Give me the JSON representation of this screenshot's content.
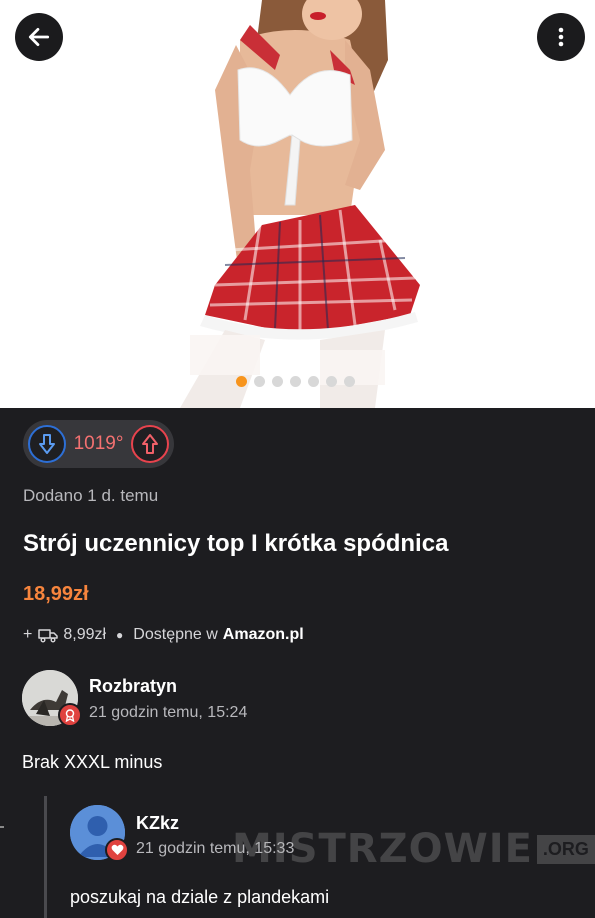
{
  "gallery": {
    "image_alt": "product-photo",
    "dot_count": 7,
    "active_dot": 0
  },
  "nav": {
    "back_icon": "arrow-left-icon",
    "more_icon": "more-vertical-icon"
  },
  "deal": {
    "temperature": "1019°",
    "added": "Dodano 1 d. temu",
    "title": "Strój uczennicy top I krótka spódnica",
    "price": "18,99zł",
    "shipping_prefix": "+",
    "shipping_cost": "8,99zł",
    "availability_label": "Dostępne w",
    "store": "Amazon.pl"
  },
  "comments": [
    {
      "user": "Rozbratyn",
      "time": "21 godzin temu, 15:24",
      "text": "Brak XXXL minus"
    },
    {
      "user": "KZkz",
      "time": "21 godzin temu, 15:33",
      "text": "poszukaj na dziale z plandekami"
    }
  ],
  "watermark": {
    "text": "MISTRZOWIE",
    "suffix": ".ORG"
  },
  "colors": {
    "background": "#1d1d20",
    "accent_orange": "#f7853d",
    "temperature_red": "#f47171",
    "downvote_blue": "#2d6fd6",
    "upvote_red": "#e8434d"
  }
}
